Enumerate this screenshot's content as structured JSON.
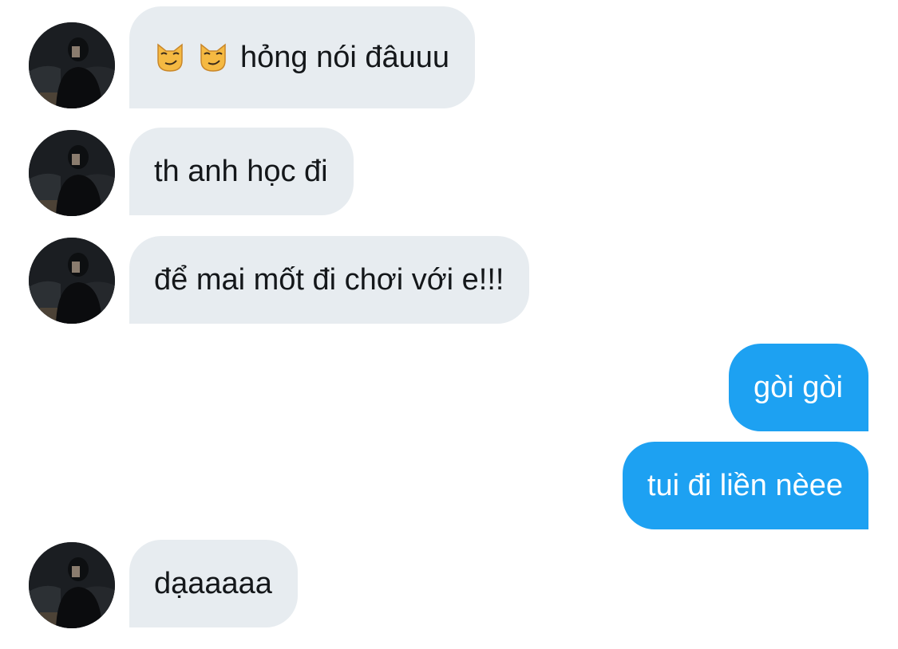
{
  "conversation": {
    "messages": [
      {
        "direction": "incoming",
        "text": "hỏng nói đâuuu",
        "emoji": [
          "smirking-cat-icon",
          "smirking-cat-icon"
        ]
      },
      {
        "direction": "incoming",
        "text": "th anh học đi"
      },
      {
        "direction": "incoming",
        "text": "để mai mốt đi chơi với e!!!"
      },
      {
        "direction": "outgoing",
        "text": "gòi gòi"
      },
      {
        "direction": "outgoing",
        "text": "tui đi liền nèee"
      },
      {
        "direction": "incoming",
        "text": "dạaaaaa"
      }
    ]
  },
  "colors": {
    "incoming_bubble": "#e7ecf0",
    "outgoing_bubble": "#1da1f2",
    "incoming_text": "#14171a",
    "outgoing_text": "#ffffff"
  }
}
